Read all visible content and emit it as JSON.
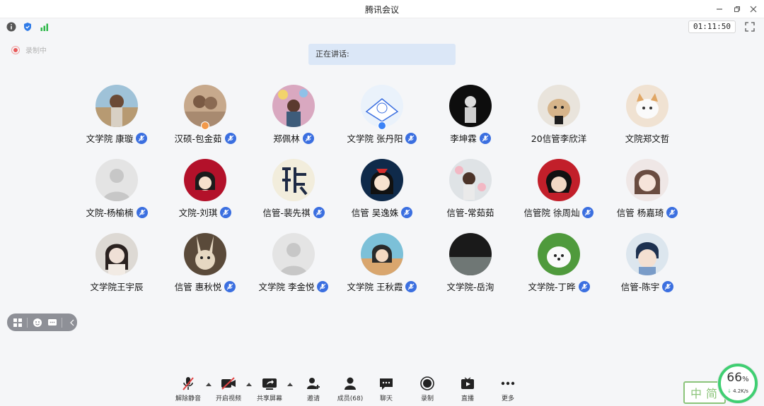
{
  "window": {
    "title": "腾讯会议"
  },
  "status": {
    "timer": "01:11:50"
  },
  "recording": {
    "label": "录制中"
  },
  "speaking": {
    "label": "正在讲话:"
  },
  "participants": [
    {
      "name": "文学院 康璇"
    },
    {
      "name": "汉硕-包金茹"
    },
    {
      "name": "郑佩林"
    },
    {
      "name": "文学院 张丹阳"
    },
    {
      "name": "李坤霖"
    },
    {
      "name": "20信管李欣洋"
    },
    {
      "name": "文院郑文哲"
    },
    {
      "name": "文院-杨榆楠"
    },
    {
      "name": "文院-刘琪"
    },
    {
      "name": "信管-裴先祺"
    },
    {
      "name": "信管 吴逸姝"
    },
    {
      "name": "信管-常茹茹"
    },
    {
      "name": "信管院 徐周灿"
    },
    {
      "name": "信管 杨嘉琦"
    },
    {
      "name": "文学院王宇辰"
    },
    {
      "name": "信管 惠秋悦"
    },
    {
      "name": "文学院 李金悦"
    },
    {
      "name": "文学院  王秋霞"
    },
    {
      "name": "文学院-岳洵"
    },
    {
      "name": "文学院-丁晔"
    },
    {
      "name": "信管-陈宇"
    }
  ],
  "toolbar": {
    "unmute": "解除静音",
    "start_video": "开启视频",
    "share_screen": "共享屏幕",
    "invite": "邀请",
    "members": "成员(68)",
    "chat": "聊天",
    "record": "录制",
    "live": "直播",
    "more": "更多"
  },
  "ime": {
    "label": "中简"
  },
  "netmon": {
    "percent": "66",
    "percent_unit": "%",
    "speed": "4.2K/s"
  },
  "colors": {
    "accent": "#3b6fe0",
    "speaking_bg": "#dbe7f7",
    "rec_red": "#e85a5a",
    "netmon_green": "#3fcf72"
  }
}
